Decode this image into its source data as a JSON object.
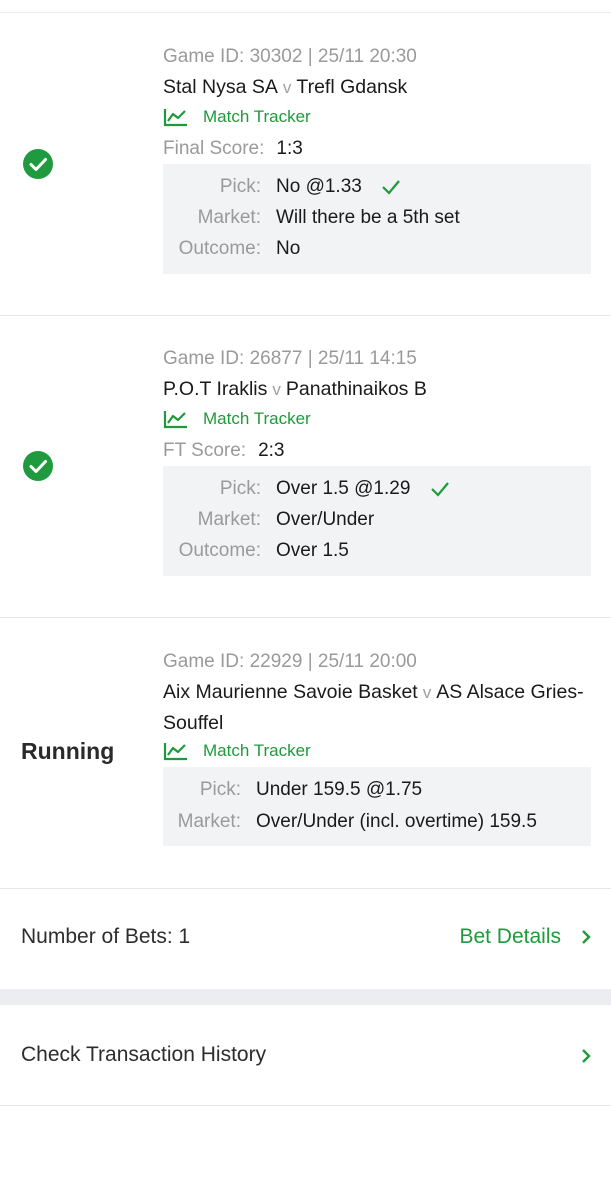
{
  "bets": [
    {
      "status": "won",
      "game_id": "Game ID: 30302 | 25/11 20:30",
      "home": "Stal Nysa SA",
      "vs": "v",
      "away": "Trefl Gdansk",
      "tracker": "Match Tracker",
      "score_label": "Final Score:",
      "score": "1:3",
      "pick_label": "Pick:",
      "pick": "No @1.33",
      "market_label": "Market:",
      "market": "Will there be a 5th set",
      "outcome_label": "Outcome:",
      "outcome": "No"
    },
    {
      "status": "won",
      "game_id": "Game ID: 26877 | 25/11 14:15",
      "home": "P.O.T Iraklis",
      "vs": "v",
      "away": "Panathinaikos B",
      "tracker": "Match Tracker",
      "score_label": "FT Score:",
      "score": "2:3",
      "pick_label": "Pick:",
      "pick": "Over 1.5 @1.29",
      "market_label": "Market:",
      "market": "Over/Under",
      "outcome_label": "Outcome:",
      "outcome": "Over 1.5"
    },
    {
      "status_text": "Running",
      "game_id": "Game ID: 22929 | 25/11 20:00",
      "home": "Aix Maurienne Savoie Basket",
      "vs": "v",
      "away": "AS Alsace Gries-Souffel",
      "tracker": "Match Tracker",
      "pick_label": "Pick:",
      "pick": "Under 159.5 @1.75",
      "market_label": "Market:",
      "market": "Over/Under (incl. overtime) 159.5"
    }
  ],
  "summary": {
    "number_of_bets": "Number of Bets: 1",
    "bet_details": "Bet Details"
  },
  "history": {
    "label": "Check Transaction History"
  },
  "colors": {
    "accent_green": "#1e9a3b",
    "status_green": "#1f9a3e"
  }
}
